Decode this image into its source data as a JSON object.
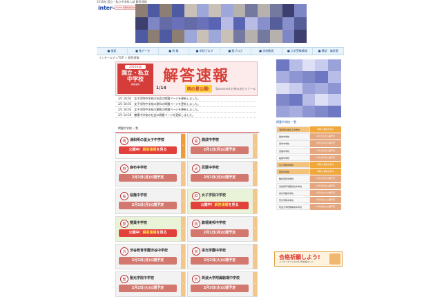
{
  "header": {
    "top_text": "2016年 国立・私立中学校入試 解答速報",
    "logo_main": "inter-edu",
    "logo_suffix": "'s",
    "small_link": "SCIRE 受験情報案内"
  },
  "nav": {
    "items": [
      "■ 検索",
      "■ 塾データ",
      "■ 特 集",
      "■ 学校ブログ",
      "■ 塾ブログ",
      "■ 学校動画",
      "■ 大学受験情報",
      "■ 模試　偏差値"
    ]
  },
  "breadcrumb": "インターエデュTOP ＞ 解答速報",
  "banner": {
    "year": "2016年度",
    "school_type": "国立・私立\n中学校",
    "sub": "解答速報",
    "title": "解答速報",
    "date": "1/14",
    "publish": "明の星公開!",
    "seminar": "Sponsored  お茶の水ゼミナール"
  },
  "news": [
    "2/1 16:03　女子学院中学校の社会の問題ページを更新しました。",
    "2/1 16:03　女子学院中学校の理科の問題ページを更新しました。",
    "2/1 16:03　女子学院中学校の算数の問題ページを更新しました。",
    "2/1 14:30　雙葉中学校の社会の問題ページを更新しました。"
  ],
  "section_title": "掲載中学校 一覧",
  "cards": [
    {
      "name": "浦和明の星女子中学校",
      "status": "pub",
      "pub_text": "公開中！",
      "hl": "解答速報",
      "tail": "を見る",
      "emb": "明",
      "style": "orange"
    },
    {
      "name": "開成中学校",
      "status": "sched",
      "label": "2月1日(月)公開予定",
      "emb": "開",
      "style": "gray"
    },
    {
      "name": "麻布中学校",
      "status": "sched",
      "label": "2月1日(月)公開予定",
      "emb": "麻",
      "style": "gray"
    },
    {
      "name": "武蔵中学校",
      "status": "sched",
      "label": "2月1日(月)公開予定",
      "emb": "武",
      "style": "gray"
    },
    {
      "name": "桜蔭中学校",
      "status": "sched",
      "label": "2月1日(月)公開予定",
      "emb": "桜",
      "style": "gray"
    },
    {
      "name": "女子学院中学校",
      "status": "pub",
      "pub_text": "公開中！",
      "hl": "解答速報",
      "tail": "を見る",
      "emb": "JG",
      "style": "green"
    },
    {
      "name": "雙葉中学校",
      "status": "pub",
      "pub_text": "公開中！",
      "hl": "解答速報",
      "tail": "を見る",
      "emb": "雙",
      "style": "green"
    },
    {
      "name": "駒場東邦中学校",
      "status": "sched",
      "label": "2月1日(月)公開予定",
      "emb": "駒",
      "style": "gray"
    },
    {
      "name": "渋谷教育学園渋谷中学校",
      "status": "sched",
      "label": "2月1日(月)公開予定",
      "emb": "渋",
      "style": "gray"
    },
    {
      "name": "栄光学園中学校",
      "status": "sched",
      "label": "2月2日(火)公開予定",
      "emb": "栄",
      "style": "gray"
    },
    {
      "name": "聖光学院中学校",
      "status": "sched",
      "label": "2月2日(火)公開予定",
      "emb": "聖",
      "style": "gray"
    },
    {
      "name": "筑波大学附属駒場中学校",
      "status": "sched",
      "label": "2月3日(水)公開予定",
      "emb": "筑",
      "style": "gray"
    }
  ],
  "side": {
    "title": "掲載中学校 一覧",
    "rows": [
      {
        "name": "浦和明の星女子中学校",
        "status": "pub",
        "label": "問題と解答を見る"
      },
      {
        "name": "開成中学校",
        "status": "sched",
        "label": "2月1日(月)公開予定"
      },
      {
        "name": "麻布中学校",
        "status": "sched",
        "label": "2月1日(月)公開予定"
      },
      {
        "name": "武蔵中学校",
        "status": "sched",
        "label": "2月1日(月)公開予定"
      },
      {
        "name": "桜蔭中学校",
        "status": "sched",
        "label": "2月1日(月)公開予定"
      },
      {
        "name": "女子学院中学校",
        "status": "pub",
        "label": "問題と解答を見る"
      },
      {
        "name": "雙葉中学校",
        "status": "pub",
        "label": "問題と解答を見る"
      },
      {
        "name": "駒場東邦中学校",
        "status": "sched",
        "label": "2月1日(月)公開予定"
      },
      {
        "name": "渋谷教育学園渋谷中学校",
        "status": "sched",
        "label": "2月1日(月)公開予定"
      },
      {
        "name": "栄光学園中学校",
        "status": "sched",
        "label": "2月2日(火)公開予定"
      },
      {
        "name": "聖光学院中学校",
        "status": "sched",
        "label": "2月2日(火)公開予定"
      },
      {
        "name": "筑波大学附属駒場中学校",
        "status": "sched",
        "label": "2月3日(水)公開予定"
      }
    ],
    "banner_text": "合格祈願しよう!",
    "banner_sub": "インターエデュの2016年合格エンパ"
  },
  "colors": {
    "accent_red": "#e2403a",
    "nav_blue": "#1e4f86",
    "pub_orange": "#f0a73b"
  }
}
